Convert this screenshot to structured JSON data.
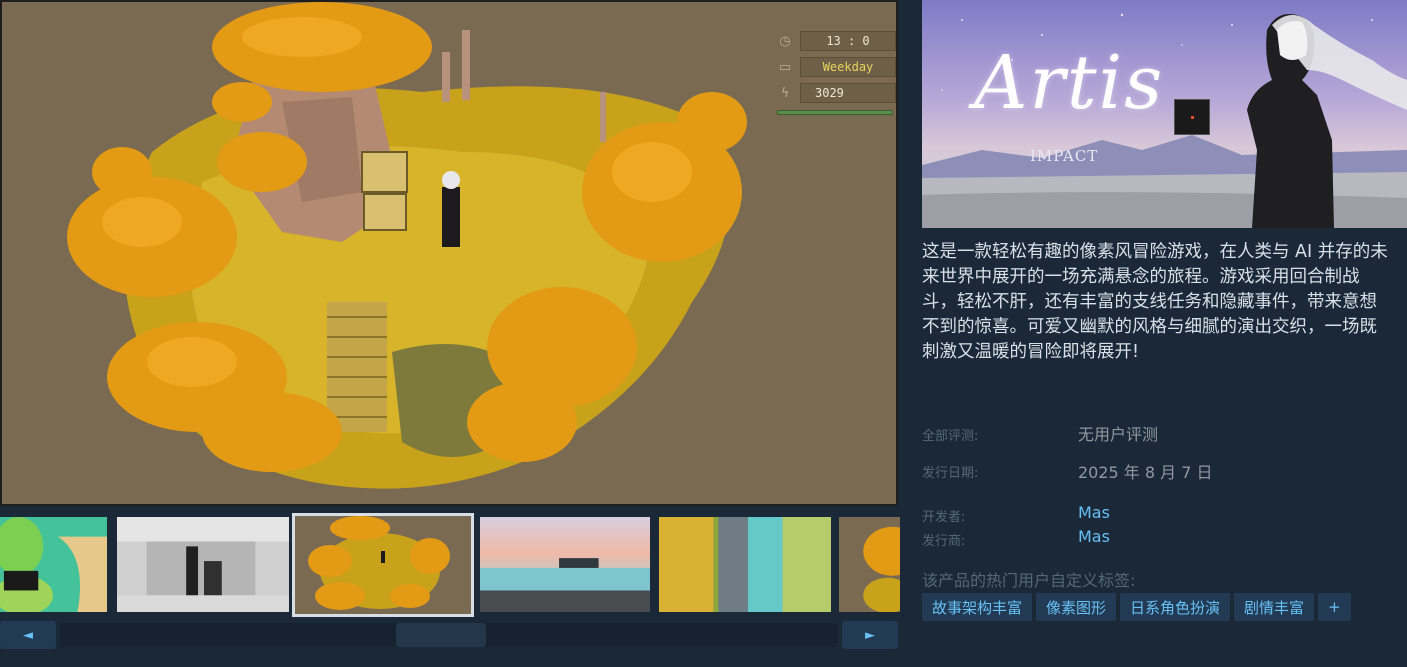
{
  "main_screenshot": {
    "hud": {
      "clock_icon": "clock-icon",
      "time": "13 : 0",
      "calendar_icon": "calendar-icon",
      "day": "Weekday",
      "money_icon": "money-icon",
      "money": "3029"
    }
  },
  "thumbnails": [
    {
      "id": "thumb-1",
      "theme": "green-map"
    },
    {
      "id": "thumb-2",
      "theme": "gray-corridor"
    },
    {
      "id": "thumb-3",
      "theme": "autumn-island",
      "selected": true
    },
    {
      "id": "thumb-4",
      "theme": "sunset-sea"
    },
    {
      "id": "thumb-5",
      "theme": "river-path"
    },
    {
      "id": "thumb-6",
      "theme": "autumn-partial"
    }
  ],
  "scrollbar": {
    "left_arrow": "◄",
    "right_arrow": "►"
  },
  "capsule": {
    "title": "Artis",
    "subtitle": "IMPACT"
  },
  "description": "这是一款轻松有趣的像素风冒险游戏，在人类与 AI 并存的未来世界中展开的一场充满悬念的旅程。游戏采用回合制战斗，轻松不肝，还有丰富的支线任务和隐藏事件，带来意想不到的惊喜。可爱又幽默的风格与细腻的演出交织，一场既刺激又温暖的冒险即将展开!",
  "reviews": {
    "label": "全部评测:",
    "value": "无用户评测"
  },
  "release": {
    "label": "发行日期:",
    "value": "2025 年 8 月 7 日"
  },
  "developer": {
    "label": "开发者:",
    "value": "Mas"
  },
  "publisher": {
    "label": "发行商:",
    "value": "Mas"
  },
  "tags_heading": "该产品的热门用户自定义标签:",
  "tags": [
    "故事架构丰富",
    "像素图形",
    "日系角色扮演",
    "剧情丰富",
    "+"
  ],
  "colors": {
    "background": "#1b2838",
    "link": "#66c0f4",
    "tag_bg": "#223a53",
    "label": "#556772"
  }
}
